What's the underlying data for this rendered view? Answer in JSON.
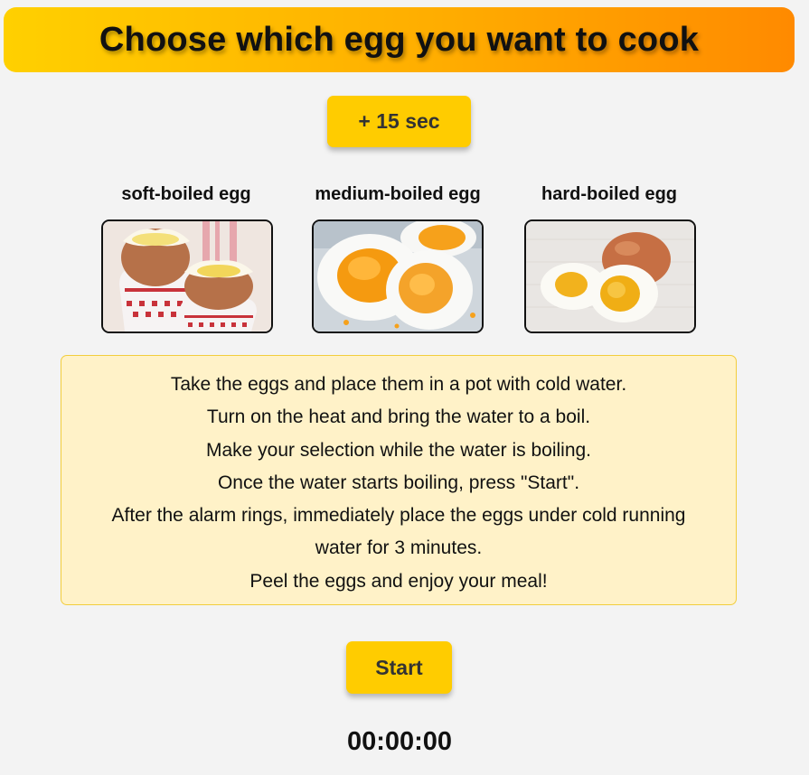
{
  "header": {
    "title": "Choose which egg you want to cook"
  },
  "controls": {
    "add_time_label": "+ 15 sec",
    "start_label": "Start"
  },
  "eggs": [
    {
      "label": "soft-boiled egg"
    },
    {
      "label": "medium-boiled egg"
    },
    {
      "label": "hard-boiled egg"
    }
  ],
  "instructions": {
    "lines": [
      "Take the eggs and place them in a pot with cold water.",
      "Turn on the heat and bring the water to a boil.",
      "Make your selection while the water is boiling.",
      "Once the water starts boiling, press \"Start\".",
      "After the alarm rings, immediately place the eggs under cold running water for 3 minutes.",
      "Peel the eggs and enjoy your meal!"
    ]
  },
  "timer": {
    "display": "00:00:00"
  },
  "colors": {
    "accent": "#ffcc00",
    "header_start": "#ffd000",
    "header_end": "#ff8a00",
    "panel_bg": "#fff2c8"
  }
}
